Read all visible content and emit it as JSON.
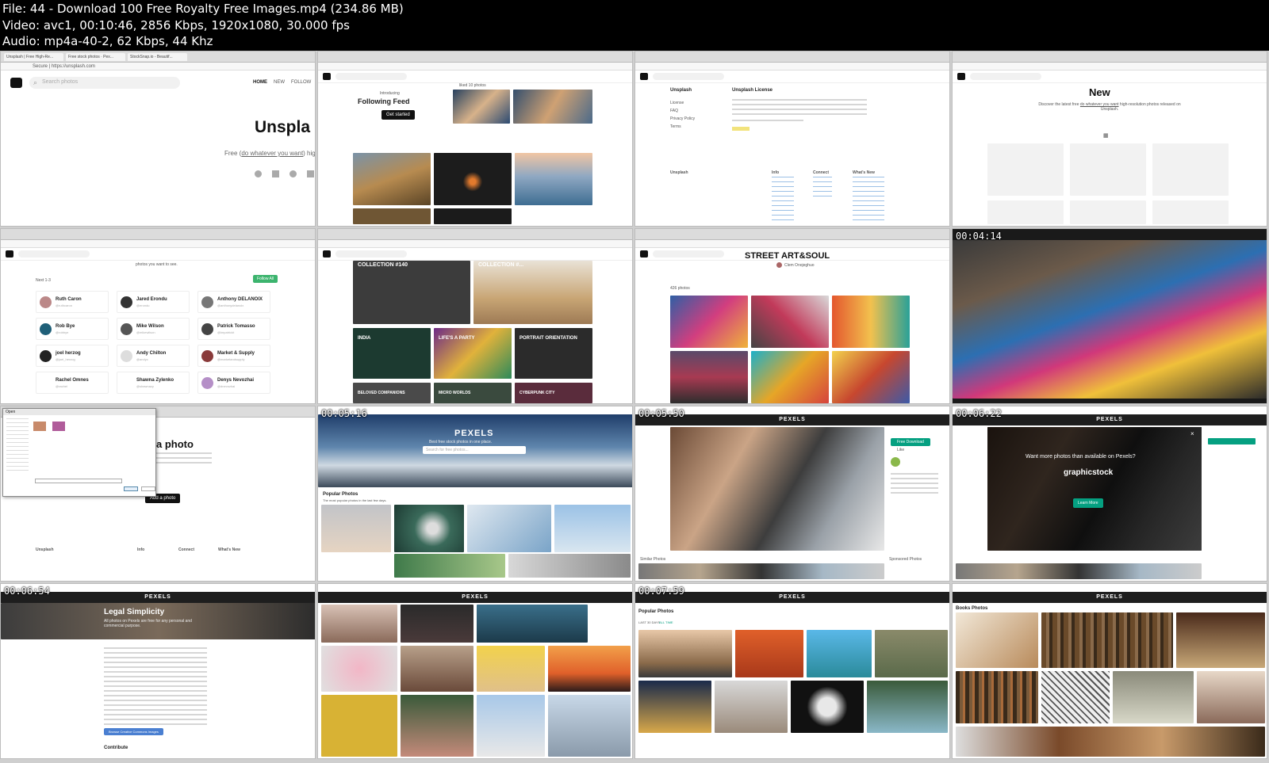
{
  "header": {
    "file_line": "File: 44 - Download 100 Free Royalty Free Images.mp4 (234.86 MB)",
    "video_line": "Video: avc1, 00:10:46, 2856 Kbps, 1920x1080, 30.000 fps",
    "audio_line": "Audio: mp4a-40-2, 62 Kbps, 44 Khz"
  },
  "colors": {
    "background": "#000000",
    "header_text": "#ffffff",
    "pexels_green": "#05a081",
    "link_blue": "#4a7fd1"
  },
  "tiles": {
    "t1": {
      "tabs": [
        "Unsplash | Free High-Re...",
        "Free stock photos · Pex...",
        "StockSnap.io - Beautif..."
      ],
      "address": "Secure | https://unsplash.com",
      "search_placeholder": "Search photos",
      "nav": [
        "HOME",
        "NEW",
        "FOLLOW"
      ],
      "title": "Unspla",
      "tagline_prefix": "Free (",
      "tagline_link": "do whatever you want",
      "tagline_suffix": ") high"
    },
    "t2": {
      "introducing": "Introducing",
      "title": "Following Feed",
      "button": "Get started",
      "liked": "liked 10 photos"
    },
    "t3": {
      "left_heading": "Unsplash",
      "right_heading": "Unsplash License",
      "left_links": [
        "License",
        "FAQ",
        "Privacy Policy",
        "Terms"
      ],
      "footer_cols": [
        "Unsplash",
        "Info",
        "Connect",
        "What's New"
      ]
    },
    "t4": {
      "title": "New",
      "subtitle": "Discover the latest free",
      "subtitle_link": "do whatever you want",
      "subtitle_end": "high-resolution photos released on Unsplash."
    },
    "t5": {
      "intro": "photos you want to see.",
      "count": "Next 1-3",
      "follow_all": "Follow All",
      "people": [
        {
          "name": "Ruth Caron",
          "handle": "@ruthcaron"
        },
        {
          "name": "Jared Erondu",
          "handle": "@erondu"
        },
        {
          "name": "Anthony DELANOIX",
          "handle": "@anthonydelanoix"
        },
        {
          "name": "Rob Bye",
          "handle": "@robbye"
        },
        {
          "name": "Mike Wilson",
          "handle": "@mikewilson"
        },
        {
          "name": "Patrick Tomasso",
          "handle": "@impatrickt"
        },
        {
          "name": "joel herzog",
          "handle": "@joel_herzog"
        },
        {
          "name": "Andy Chilton",
          "handle": "@andyc"
        },
        {
          "name": "Market & Supply",
          "handle": "@marketandsupply"
        },
        {
          "name": "Rachel Omnes",
          "handle": "@rachel"
        },
        {
          "name": "Shawna Zylenko",
          "handle": "@shawnazy"
        },
        {
          "name": "Denys Nevozhai",
          "handle": "@dnevozhai"
        }
      ]
    },
    "t6": {
      "collections": [
        "COLLECTION #140",
        "COLLECTION #...",
        "INDIA",
        "LIFE'S A PARTY",
        "PORTRAIT ORIENTATION",
        "BELOVED COMPANIONS",
        "MICRO WORLDS",
        "CYBERPUNK CITY"
      ]
    },
    "t7": {
      "title": "STREET ART&SOUL",
      "author": "Clem Onojeghuo",
      "count": "426 photos"
    },
    "t8": {
      "timestamp": "00:04:14"
    },
    "t9": {
      "title": "a photo",
      "button": "Add a photo",
      "dialog_title": "Open",
      "footer_cols": [
        "Unsplash",
        "Info",
        "Connect",
        "What's New"
      ]
    },
    "t10": {
      "timestamp": "00:05:16",
      "logo": "PEXELS",
      "tagline": "Best free stock photos in one place.",
      "search_placeholder": "Search for free photos...",
      "popular": "Popular Photos",
      "popular_sub": "The most popular photos in the last few days."
    },
    "t11": {
      "timestamp": "00:05:50",
      "logo": "PEXELS",
      "download": "Free Download",
      "like": "Like",
      "more": "Similar Photos",
      "sponsored": "Sponsored Photos"
    },
    "t12": {
      "timestamp": "00:06:22",
      "logo": "PEXELS",
      "overlay_title": "Want more photos than available on Pexels?",
      "overlay_brand": "graphicstock",
      "overlay_button": "Learn More"
    },
    "t13": {
      "timestamp": "00:06:54",
      "logo": "PEXELS",
      "title": "Legal Simplicity",
      "subtitle": "All photos on Pexels are free for any personal and commercial purpose.",
      "button": "Browse Creative Commons Images",
      "contribute": "Contribute"
    },
    "t14": {
      "logo": "PEXELS"
    },
    "t15": {
      "timestamp": "00:07:59",
      "logo": "PEXELS",
      "popular": "Popular Photos",
      "tabs": [
        "LAST 30 DAYS",
        "ALL TIME"
      ]
    },
    "t16": {
      "logo": "PEXELS",
      "title": "Books Photos"
    }
  }
}
